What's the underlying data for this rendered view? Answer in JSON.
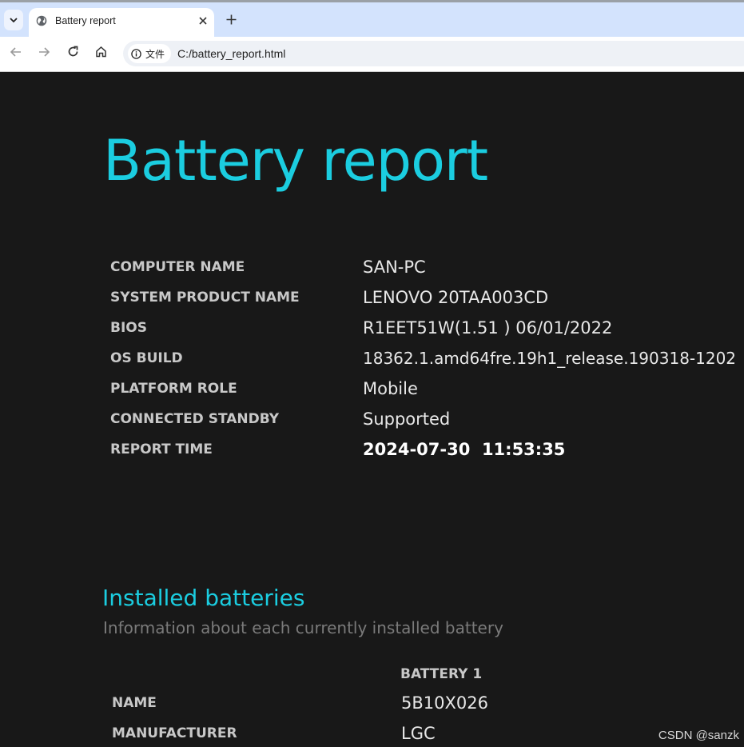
{
  "browser": {
    "tab": {
      "title": "Battery report",
      "favicon": "globe-icon",
      "close_icon": "close-icon"
    },
    "new_tab_icon": "plus-icon",
    "tab_menu_icon": "chevron-down-icon",
    "nav": {
      "back_icon": "arrow-left-icon",
      "forward_icon": "arrow-right-icon",
      "reload_icon": "reload-icon",
      "home_icon": "home-icon"
    },
    "omnibox": {
      "chip_label": "文件",
      "url": "C:/battery_report.html"
    }
  },
  "report": {
    "title": "Battery report",
    "info": [
      {
        "label": "COMPUTER NAME",
        "value": "SAN-PC"
      },
      {
        "label": "SYSTEM PRODUCT NAME",
        "value": "LENOVO 20TAA003CD"
      },
      {
        "label": "BIOS",
        "value": "R1EET51W(1.51 ) 06/01/2022"
      },
      {
        "label": "OS BUILD",
        "value": "18362.1.amd64fre.19h1_release.190318-1202"
      },
      {
        "label": "PLATFORM ROLE",
        "value": "Mobile"
      },
      {
        "label": "CONNECTED STANDBY",
        "value": "Supported"
      },
      {
        "label": "REPORT TIME",
        "value": "2024-07-30  11:53:35"
      }
    ],
    "installed": {
      "title": "Installed batteries",
      "subtitle": "Information about each currently installed battery",
      "column_header": "BATTERY 1",
      "rows": [
        {
          "label": "NAME",
          "value": "5B10X026"
        },
        {
          "label": "MANUFACTURER",
          "value": "LGC"
        }
      ]
    }
  },
  "watermark": "CSDN @sanzk",
  "colors": {
    "accent": "#1bcde0",
    "background": "#181818",
    "label": "#c8c8c8",
    "value": "#e8e8e8"
  }
}
